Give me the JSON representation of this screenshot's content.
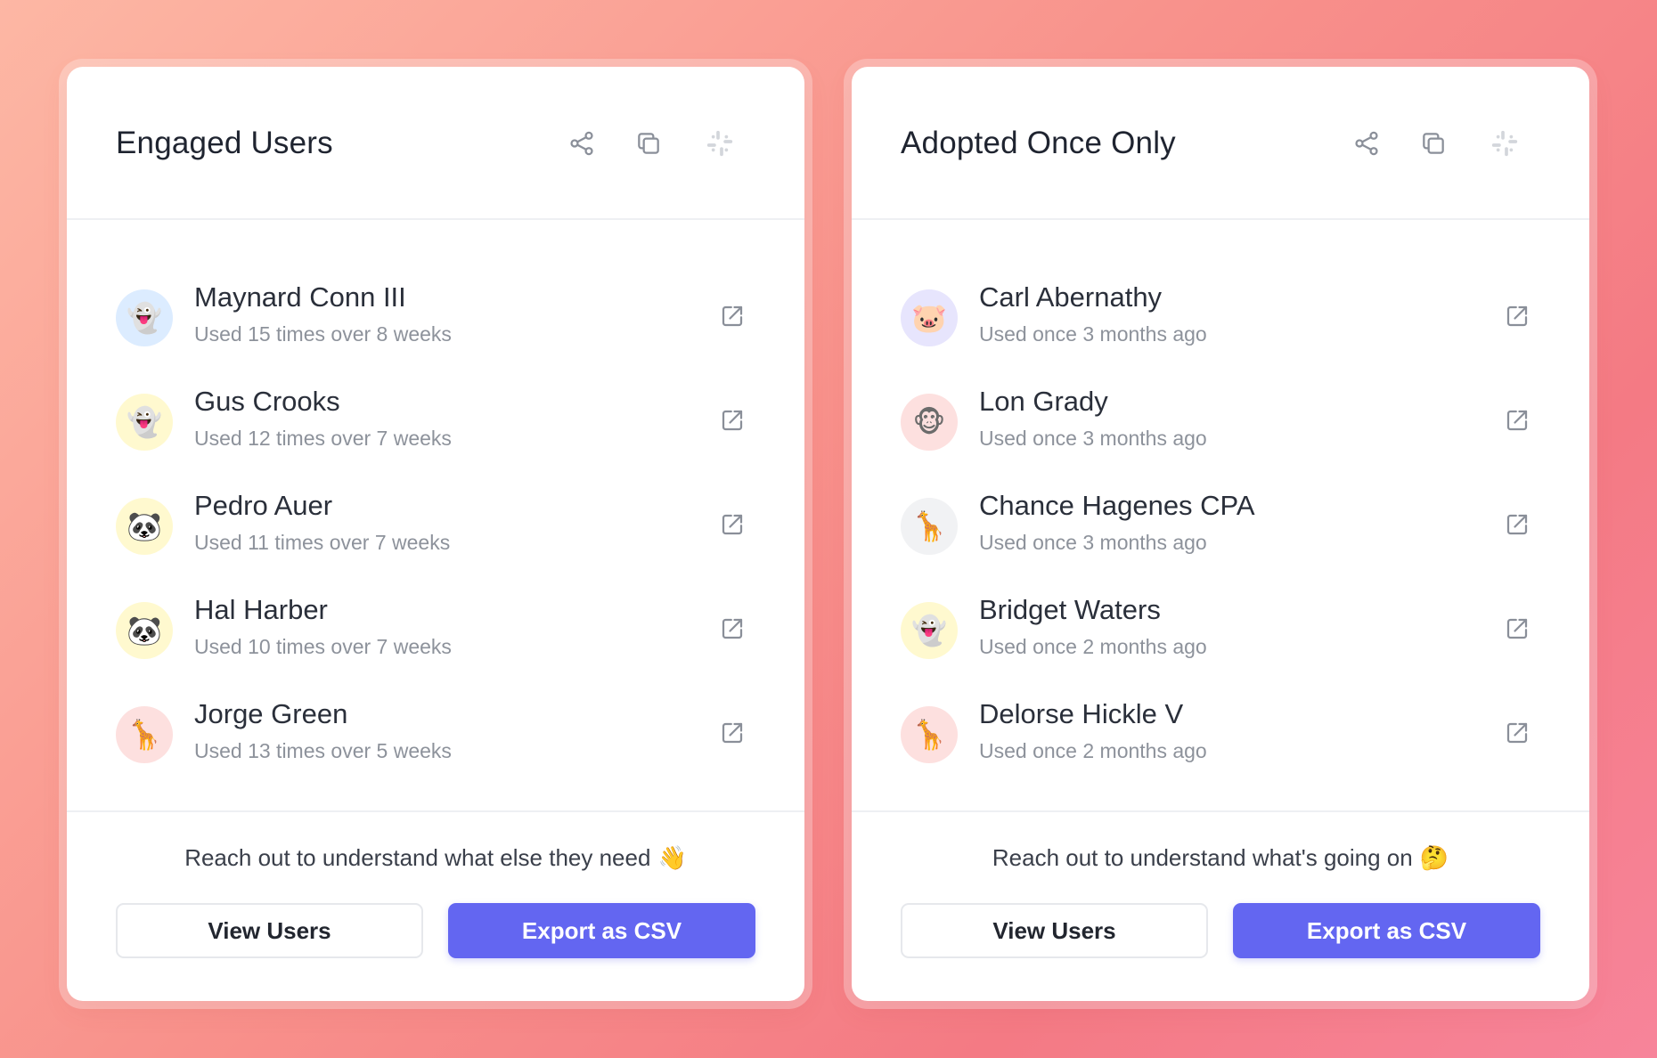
{
  "cards": [
    {
      "title": "Engaged Users",
      "header_icons": [
        "share-icon",
        "copy-icon",
        "slack-icon"
      ],
      "users": [
        {
          "name": "Maynard Conn III",
          "detail": "Used 15 times over 8 weeks",
          "avatar": "👻",
          "avatar_bg": "#dcecff"
        },
        {
          "name": "Gus Crooks",
          "detail": "Used 12 times over 7 weeks",
          "avatar": "👻",
          "avatar_bg": "#fff9cf"
        },
        {
          "name": "Pedro Auer",
          "detail": "Used 11 times over 7 weeks",
          "avatar": "🐼",
          "avatar_bg": "#fff9cf"
        },
        {
          "name": "Hal Harber",
          "detail": "Used 10 times over 7 weeks",
          "avatar": "🐼",
          "avatar_bg": "#fff9cf"
        },
        {
          "name": "Jorge Green",
          "detail": "Used 13 times over 5 weeks",
          "avatar": "🦒",
          "avatar_bg": "#fde0df"
        }
      ],
      "footer_note": "Reach out to understand what else they need",
      "footer_emoji": "👋",
      "view_label": "View Users",
      "export_label": "Export as CSV"
    },
    {
      "title": "Adopted Once Only",
      "header_icons": [
        "share-icon",
        "copy-icon",
        "slack-icon"
      ],
      "users": [
        {
          "name": "Carl Abernathy",
          "detail": "Used once 3 months ago",
          "avatar": "🐷",
          "avatar_bg": "#e7e5fd"
        },
        {
          "name": "Lon Grady",
          "detail": "Used once 3 months ago",
          "avatar": "🐵",
          "avatar_bg": "#fde0df"
        },
        {
          "name": "Chance Hagenes CPA",
          "detail": "Used once 3 months ago",
          "avatar": "🦒",
          "avatar_bg": "#f1f2f4"
        },
        {
          "name": "Bridget Waters",
          "detail": "Used once 2 months ago",
          "avatar": "👻",
          "avatar_bg": "#fff9cf"
        },
        {
          "name": "Delorse Hickle V",
          "detail": "Used once 2 months ago",
          "avatar": "🦒",
          "avatar_bg": "#fde0df"
        }
      ],
      "footer_note": "Reach out to understand what's going on",
      "footer_emoji": "🤔",
      "view_label": "View Users",
      "export_label": "Export as CSV"
    }
  ],
  "colors": {
    "accent": "#6366f1",
    "text_primary": "#2a2f3a",
    "text_secondary": "#8d929b",
    "icon": "#8a8f99"
  },
  "row_icon": "external-link-icon"
}
